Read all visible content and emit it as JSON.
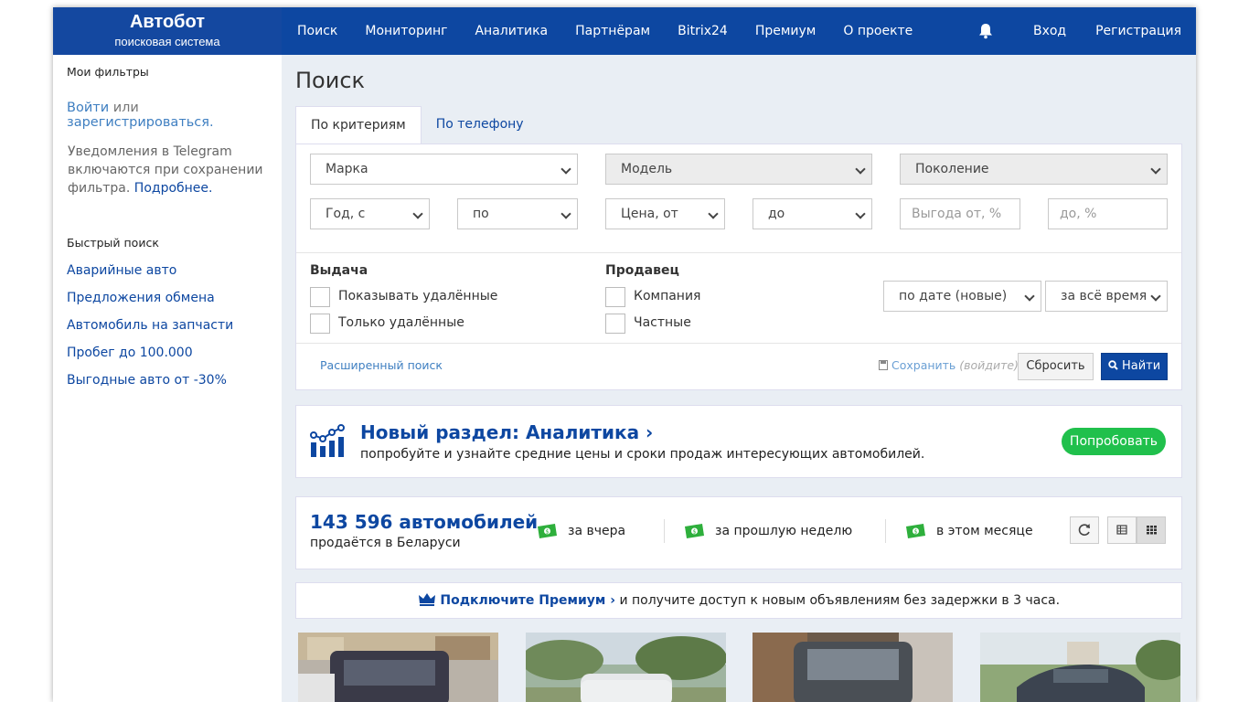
{
  "header": {
    "brand_title": "Автобот",
    "brand_subtitle": "поисковая система",
    "nav": [
      "Поиск",
      "Мониторинг",
      "Аналитика",
      "Партнёрам",
      "Bitrix24",
      "Премиум",
      "О проекте"
    ],
    "login": "Вход",
    "register": "Регистрация",
    "bell_icon": "bell-icon"
  },
  "sidebar": {
    "my_filters": "Мои фильтры",
    "login_link": "Войти",
    "or_text": "или",
    "register_link": "зарегистрироваться.",
    "telegram_note": "Уведомления в Telegram включаются при сохранении фильтра.",
    "more_link": "Подробнее.",
    "quick_search": "Быстрый поиск",
    "quick_items": [
      "Аварийные авто",
      "Предложения обмена",
      "Автомобиль на запчасти",
      "Пробег до 100.000",
      "Выгодные авто от -30%"
    ]
  },
  "main": {
    "title": "Поиск",
    "tabs": [
      "По критериям",
      "По телефону"
    ],
    "filters": {
      "make": "Марка",
      "model": "Модель",
      "generation": "Поколение",
      "year_from": "Год, с",
      "year_to": "по",
      "price_from": "Цена, от",
      "price_to": "до",
      "profit_from_placeholder": "Выгода от, %",
      "profit_to_placeholder": "до, %"
    },
    "output": {
      "title": "Выдача",
      "show_deleted": "Показывать удалённые",
      "only_deleted": "Только удалённые"
    },
    "seller": {
      "title": "Продавец",
      "company": "Компания",
      "private": "Частные"
    },
    "sort": "по дате (новые)",
    "period": "за всё время",
    "advanced_search": "Расширенный поиск",
    "save": "Сохранить",
    "save_hint": "(войдите)",
    "reset": "Сбросить",
    "find": "Найти"
  },
  "promo": {
    "title": "Новый раздел: Аналитика ›",
    "description": "попробуйте и узнайте средние цены и сроки продаж интересующих автомобилей.",
    "button": "Попробовать"
  },
  "stats": {
    "count": "143 596 автомобилей",
    "subtitle": "продаётся в Беларуси",
    "periods": [
      "за вчера",
      "за прошлую неделю",
      "в этом месяце"
    ]
  },
  "premium": {
    "link": "Подключите Премиум ›",
    "text": "и получите доступ к новым объявлениям без задержки в 3 часа."
  },
  "colors": {
    "brand": "#0d47a1",
    "accent_green": "#20c04c",
    "money_icon": "#2eaf3c"
  }
}
